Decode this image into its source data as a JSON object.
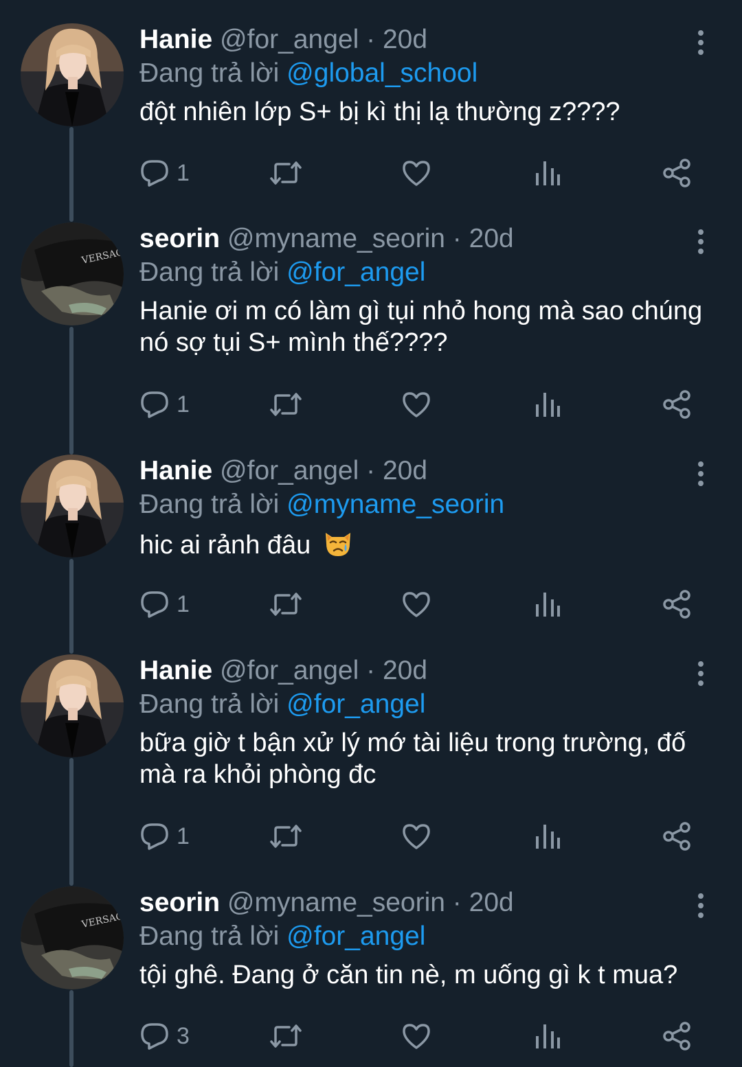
{
  "tweets": [
    {
      "name": "Hanie",
      "handle": "@for_angel",
      "dot": "·",
      "time": "20d",
      "reply_prefix": "Đang trả lời",
      "reply_to": "@global_school",
      "text": "đột nhiên lớp S+ bị kì thị lạ thường z????",
      "reply_count": "1",
      "avatar": "hanie"
    },
    {
      "name": "seorin",
      "handle": "@myname_seorin",
      "dot": "·",
      "time": "20d",
      "reply_prefix": "Đang trả lời",
      "reply_to": "@for_angel",
      "text": "Hanie ơi m có làm gì tụi nhỏ hong mà sao chúng nó sợ tụi S+ mình thế????",
      "reply_count": "1",
      "avatar": "seorin"
    },
    {
      "name": "Hanie",
      "handle": "@for_angel",
      "dot": "·",
      "time": "20d",
      "reply_prefix": "Đang trả lời",
      "reply_to": "@myname_seorin",
      "text": "hic ai rảnh đâu",
      "emoji": "crying-cat-face",
      "reply_count": "1",
      "avatar": "hanie"
    },
    {
      "name": "Hanie",
      "handle": "@for_angel",
      "dot": "·",
      "time": "20d",
      "reply_prefix": "Đang trả lời",
      "reply_to": "@for_angel",
      "text": "bữa giờ t bận xử lý mớ tài liệu trong trường, đố mà ra khỏi phòng đc",
      "reply_count": "1",
      "avatar": "hanie"
    },
    {
      "name": "seorin",
      "handle": "@myname_seorin",
      "dot": "·",
      "time": "20d",
      "reply_prefix": "Đang trả lời",
      "reply_to": "@for_angel",
      "text": "tội ghê. Đang ở căn tin nè, m uống gì k t mua?",
      "reply_count": "3",
      "avatar": "seorin"
    }
  ],
  "icons": {
    "reply": "reply-icon",
    "retweet": "retweet-icon",
    "like": "heart-icon",
    "views": "analytics-icon",
    "share": "share-icon",
    "more": "more-vertical-icon"
  },
  "colors": {
    "background": "#15202b",
    "text": "#ffffff",
    "secondary": "#8b98a5",
    "link": "#1d9bf0",
    "thread_line": "#3d4d5c"
  }
}
